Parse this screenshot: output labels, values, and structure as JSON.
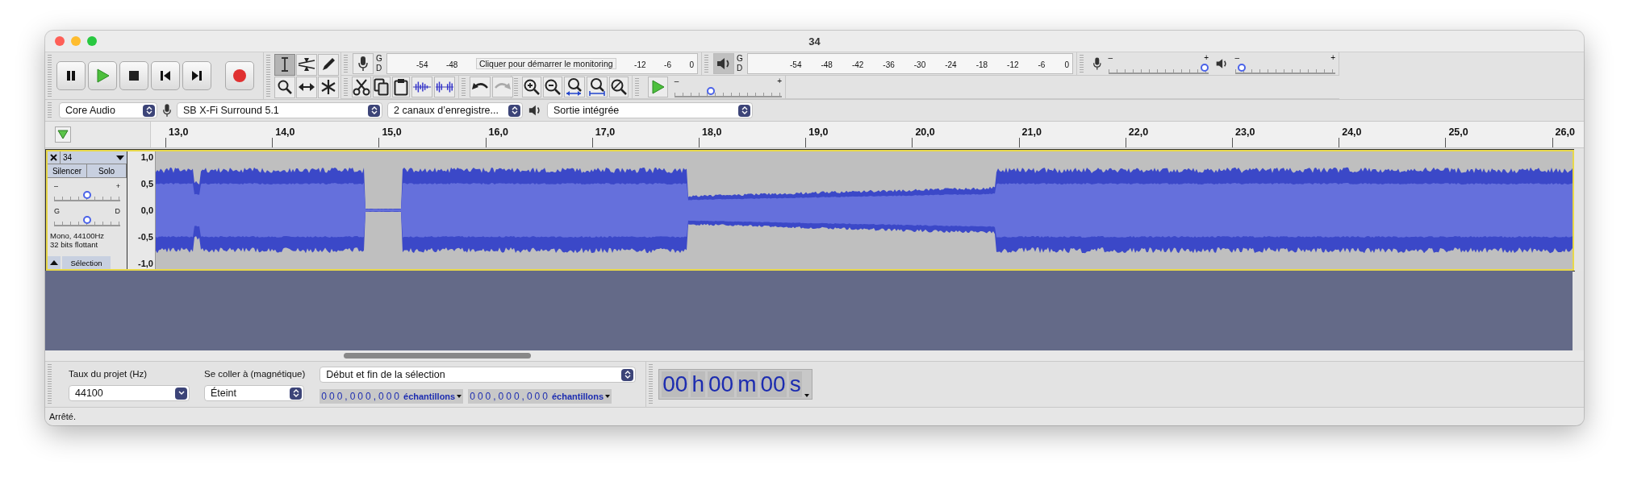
{
  "window": {
    "title": "34"
  },
  "tools": [
    {
      "kind": "select",
      "selected": true
    },
    {
      "kind": "envelope",
      "selected": false
    },
    {
      "kind": "draw",
      "selected": false
    },
    {
      "kind": "zoom",
      "selected": false
    },
    {
      "kind": "timeshift",
      "selected": false
    },
    {
      "kind": "multi",
      "selected": false
    }
  ],
  "undo_redo": [
    {
      "kind": "undo",
      "disabled": false
    },
    {
      "kind": "redo",
      "disabled": true
    }
  ],
  "recording_meter": {
    "channels": [
      "G",
      "D"
    ],
    "ticks_before": [
      "-54",
      "-48"
    ],
    "message": "Cliquer pour démarrer le monitoring",
    "ticks_after": [
      "-12",
      "-6",
      "0"
    ]
  },
  "playback_meter": {
    "channels": [
      "G",
      "D"
    ],
    "ticks": [
      "-54",
      "-48",
      "-42",
      "-36",
      "-30",
      "-24",
      "-18",
      "-12",
      "-6",
      "0"
    ]
  },
  "mixer": {
    "record_volume": {
      "min": "–",
      "max": "+",
      "level": 1.0
    },
    "playback_volume": {
      "min": "–",
      "max": "+",
      "level": 0.03
    }
  },
  "play_at_speed": {
    "min": "–",
    "max": "+",
    "level": 0.33
  },
  "devices": {
    "host": "Core Audio",
    "recording_device": "SB X-Fi Surround 5.1",
    "channels": "2 canaux d’enregistre...",
    "playback_device": "Sortie intégrée"
  },
  "timeline": {
    "labels": [
      "13,0",
      "14,0",
      "15,0",
      "16,0",
      "17,0",
      "18,0",
      "19,0",
      "20,0",
      "21,0",
      "22,0",
      "23,0",
      "24,0",
      "25,0",
      "26,0"
    ]
  },
  "track": {
    "name": "34",
    "selected": true,
    "mute": {
      "label": "Silencer",
      "selected": false
    },
    "solo": {
      "label": "Solo",
      "selected": false
    },
    "gain": {
      "min": "–",
      "max": "+",
      "level": 0.5
    },
    "pan": {
      "min": "G",
      "max": "D",
      "level": 0.5
    },
    "info": [
      "Mono, 44100Hz",
      "32 bits flottant"
    ],
    "select_button": "Sélection",
    "y_labels": [
      "1,0",
      "0,5",
      "0,0",
      "-0,5",
      "-1,0"
    ]
  },
  "selection_toolbar": {
    "rate": {
      "label": "Taux du projet (Hz)",
      "value": "44100"
    },
    "snap": {
      "label": "Se coller à (magnétique)",
      "value": "Éteint"
    },
    "mode": "Début et fin de la sélection",
    "start": {
      "digits": "000,000,000",
      "unit": "échantillons"
    },
    "end": {
      "digits": "000,000,000",
      "unit": "échantillons"
    }
  },
  "time_display": [
    {
      "value": "00",
      "unit": "h"
    },
    {
      "value": "00",
      "unit": "m"
    },
    {
      "value": "00",
      "unit": "s"
    }
  ],
  "status_bar": "Arrêté."
}
